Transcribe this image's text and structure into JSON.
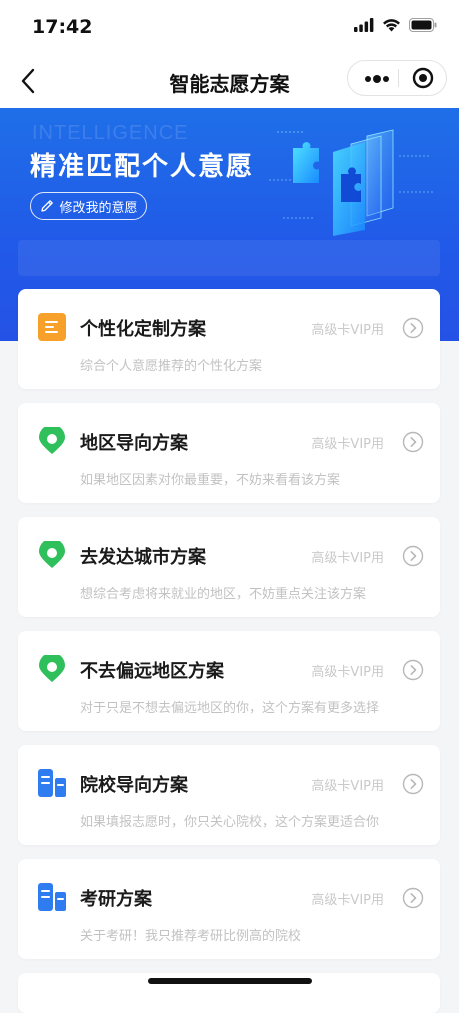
{
  "status": {
    "time": "17:42"
  },
  "nav": {
    "title": "智能志愿方案"
  },
  "banner": {
    "watermark": "INTELLIGENCE",
    "title": "精准匹配个人意愿",
    "modify_label": "修改我的意愿"
  },
  "cards": [
    {
      "title": "个性化定制方案",
      "vip": "高级卡VIP用",
      "desc": "综合个人意愿推荐的个性化方案",
      "icon": "document-icon"
    },
    {
      "title": "地区导向方案",
      "vip": "高级卡VIP用",
      "desc": "如果地区因素对你最重要，不妨来看看该方案",
      "icon": "location-pin-icon"
    },
    {
      "title": "去发达城市方案",
      "vip": "高级卡VIP用",
      "desc": "想综合考虑将来就业的地区，不妨重点关注该方案",
      "icon": "location-pin-icon"
    },
    {
      "title": "不去偏远地区方案",
      "vip": "高级卡VIP用",
      "desc": "对于只是不想去偏远地区的你，这个方案有更多选择",
      "icon": "location-pin-icon"
    },
    {
      "title": "院校导向方案",
      "vip": "高级卡VIP用",
      "desc": "如果填报志愿时，你只关心院校，这个方案更适合你",
      "icon": "school-icon"
    },
    {
      "title": "考研方案",
      "vip": "高级卡VIP用",
      "desc": "关于考研！我只推荐考研比例高的院校",
      "icon": "school-icon"
    }
  ],
  "colors": {
    "primary_blue": "#2159e8",
    "icon_orange": "#f7a12a",
    "icon_green": "#2fc05c",
    "icon_blue": "#2f7cf0"
  }
}
